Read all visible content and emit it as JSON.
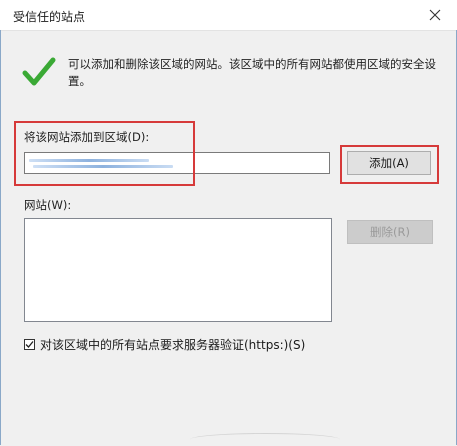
{
  "window": {
    "title": "受信任的站点",
    "close_icon": "close-icon"
  },
  "info": {
    "icon": "checkmark-icon",
    "text": "可以添加和删除该区域的网站。该区域中的所有网站都使用区域的安全设置。"
  },
  "add_site": {
    "label": "将该网站添加到区域(D):",
    "value": "",
    "add_button_label": "添加(A)"
  },
  "sites": {
    "label": "网站(W):",
    "items": [],
    "remove_button_label": "删除(R)"
  },
  "https": {
    "checked": true,
    "label": "对该区域中的所有站点要求服务器验证(https:)(S)"
  },
  "colors": {
    "accent_green": "#3aa935",
    "annotation_red": "#d63a3a",
    "dialog_bg": "#f0f0f0"
  }
}
